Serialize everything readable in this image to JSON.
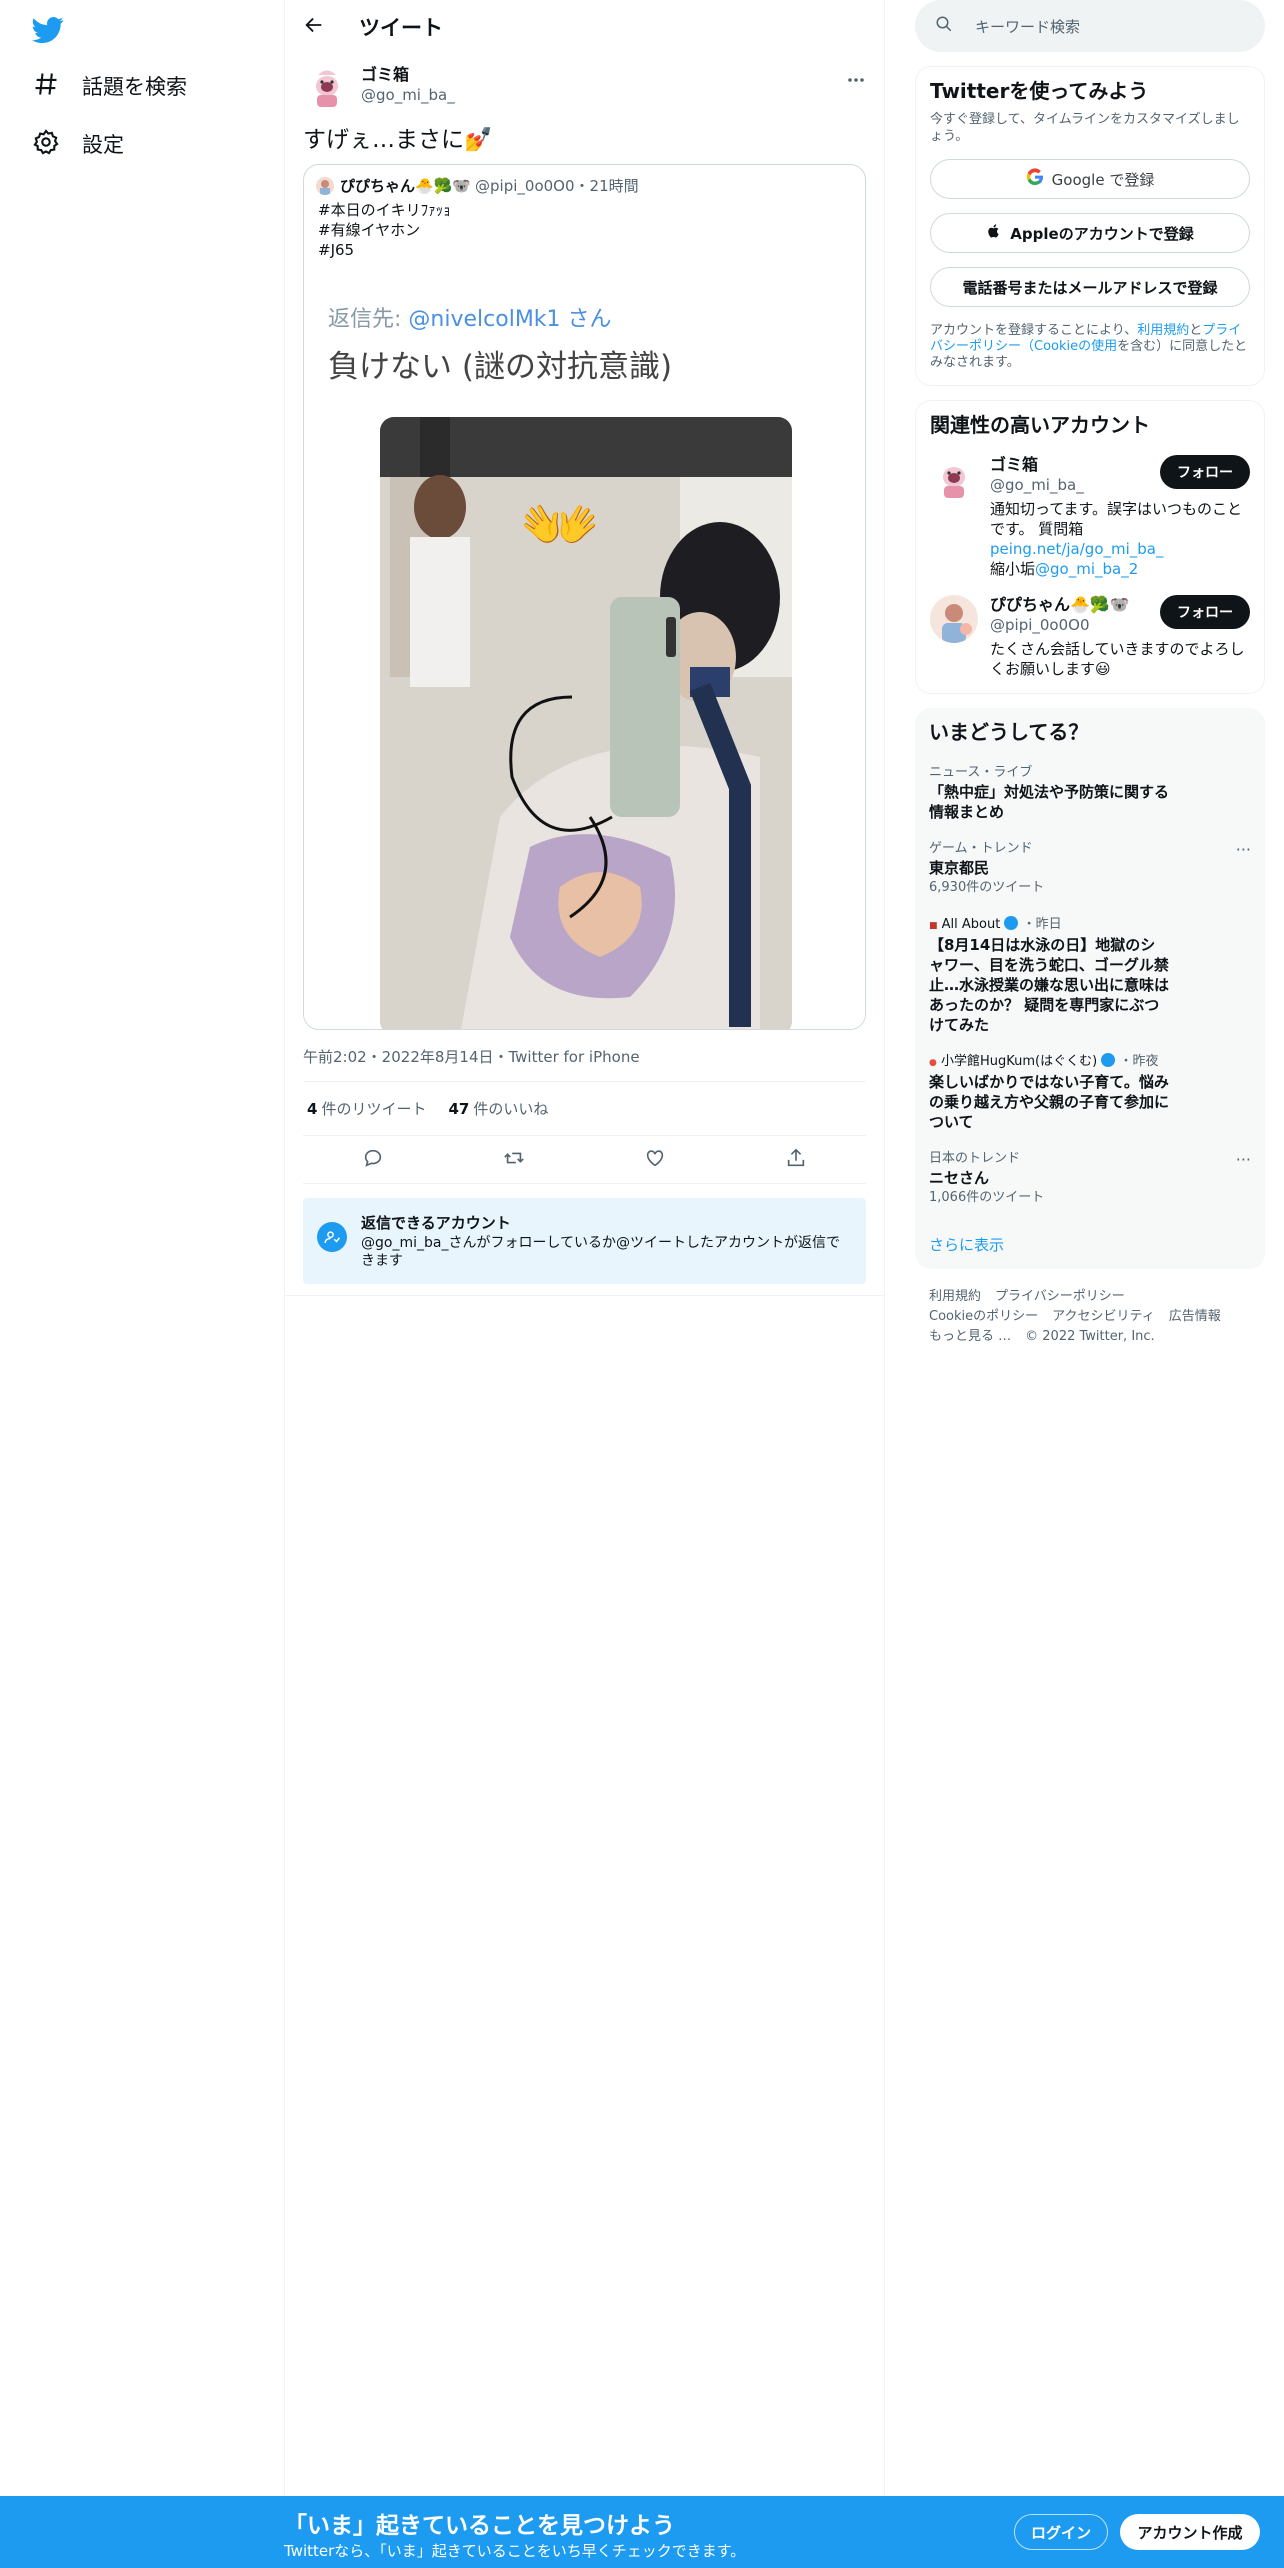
{
  "nav": {
    "logo_icon": "twitter-bird-icon",
    "items": [
      {
        "label": "話題を検索",
        "icon": "hashtag-icon"
      },
      {
        "label": "設定",
        "icon": "gear-icon"
      }
    ]
  },
  "main": {
    "back_icon": "arrow-left-icon",
    "title": "ツイート",
    "tweet": {
      "author_name": "ゴミ箱",
      "author_handle": "@go_mi_ba_",
      "text": "すげぇ…まさに💅",
      "quote": {
        "name": "ぴぴちゃん🐣🥦🐨",
        "handle": "@pipi_0o0O0",
        "time": "21時間",
        "lines": [
          "#本日のイキリﾌｧｯｮ",
          "#有線イヤホン",
          "#J65"
        ],
        "image_reply_label": "返信先:",
        "image_reply_target": "@nivelcolMk1 さん",
        "image_caption": "負けない (謎の対抗意識)"
      },
      "meta": "午前2:02・2022年8月14日・Twitter for iPhone",
      "retweets_count": "4",
      "retweets_label": "件のリツイート",
      "likes_count": "47",
      "likes_label": "件のいいね"
    },
    "reply_box": {
      "title": "返信できるアカウント",
      "text": "@go_mi_ba_さんがフォローしているか@ツイートしたアカウントが返信できます"
    }
  },
  "right": {
    "search_placeholder": "キーワード検索",
    "signup": {
      "title": "Twitterを使ってみよう",
      "desc": "今すぐ登録して、タイムラインをカスタマイズしましょう。",
      "google_label": "Google で登録",
      "apple_label": "Appleのアカウントで登録",
      "phone_label": "電話番号またはメールアドレスで登録",
      "legal_prefix": "アカウントを登録することにより、",
      "legal_terms": "利用規約",
      "legal_and": "と",
      "legal_privacy": "プライバシーポリシー",
      "legal_cookie": "（Cookieの使用",
      "legal_suffix": "を含む）に同意したとみなされます。"
    },
    "related": {
      "title": "関連性の高いアカウント",
      "follow_label": "フォロー",
      "accounts": [
        {
          "name": "ゴミ箱",
          "handle": "@go_mi_ba_",
          "bio": "通知切ってます。誤字はいつものことです。 質問箱",
          "bio_link": "peing.net/ja/go_mi_ba_",
          "bio_extra": "縮小垢",
          "bio_link2": "@go_mi_ba_2"
        },
        {
          "name": "ぴぴちゃん🐣🥦🐨",
          "handle": "@pipi_0o0O0",
          "bio": "たくさん会話していきますのでよろしくお願いします😃"
        }
      ]
    },
    "trends": {
      "title": "いまどうしてる？",
      "items": [
        {
          "category": "ニュース・ライブ",
          "title": "「熱中症」対処法や予防策に関する情報まとめ",
          "count": ""
        },
        {
          "category": "ゲーム・トレンド",
          "title": "東京都民",
          "count": "6,930件のツイート"
        },
        {
          "category": "All About",
          "time": "・昨日",
          "title": "【8月14日は水泳の日】地獄のシャワー、目を洗う蛇口、ゴーグル禁止…水泳授業の嫌な思い出に意味はあったのか？ 疑問を専門家にぶつけてみた",
          "count": ""
        },
        {
          "category": "小学館HugKum(はぐくむ)",
          "time": "・昨夜",
          "title": "楽しいばかりではない子育て。悩みの乗り越え方や父親の子育て参加について",
          "count": ""
        },
        {
          "category": "日本のトレンド",
          "title": "ニセさん",
          "count": "1,066件のツイート"
        }
      ],
      "show_more": "さらに表示"
    },
    "footer": {
      "line1": [
        "利用規約",
        "プライバシーポリシー"
      ],
      "line2": [
        "Cookieのポリシー",
        "アクセシビリティ",
        "広告情報"
      ],
      "line3": [
        "もっと見る …",
        "© 2022 Twitter, Inc."
      ]
    }
  },
  "bottom_bar": {
    "title": "「いま」起きていることを見つけよう",
    "subtitle": "Twitterなら、「いま」起きていることをいち早くチェックできます。",
    "login_label": "ログイン",
    "signup_label": "アカウント作成"
  },
  "colors": {
    "accent": "#1d9bf0",
    "text": "#0f1419",
    "muted": "#536471"
  }
}
